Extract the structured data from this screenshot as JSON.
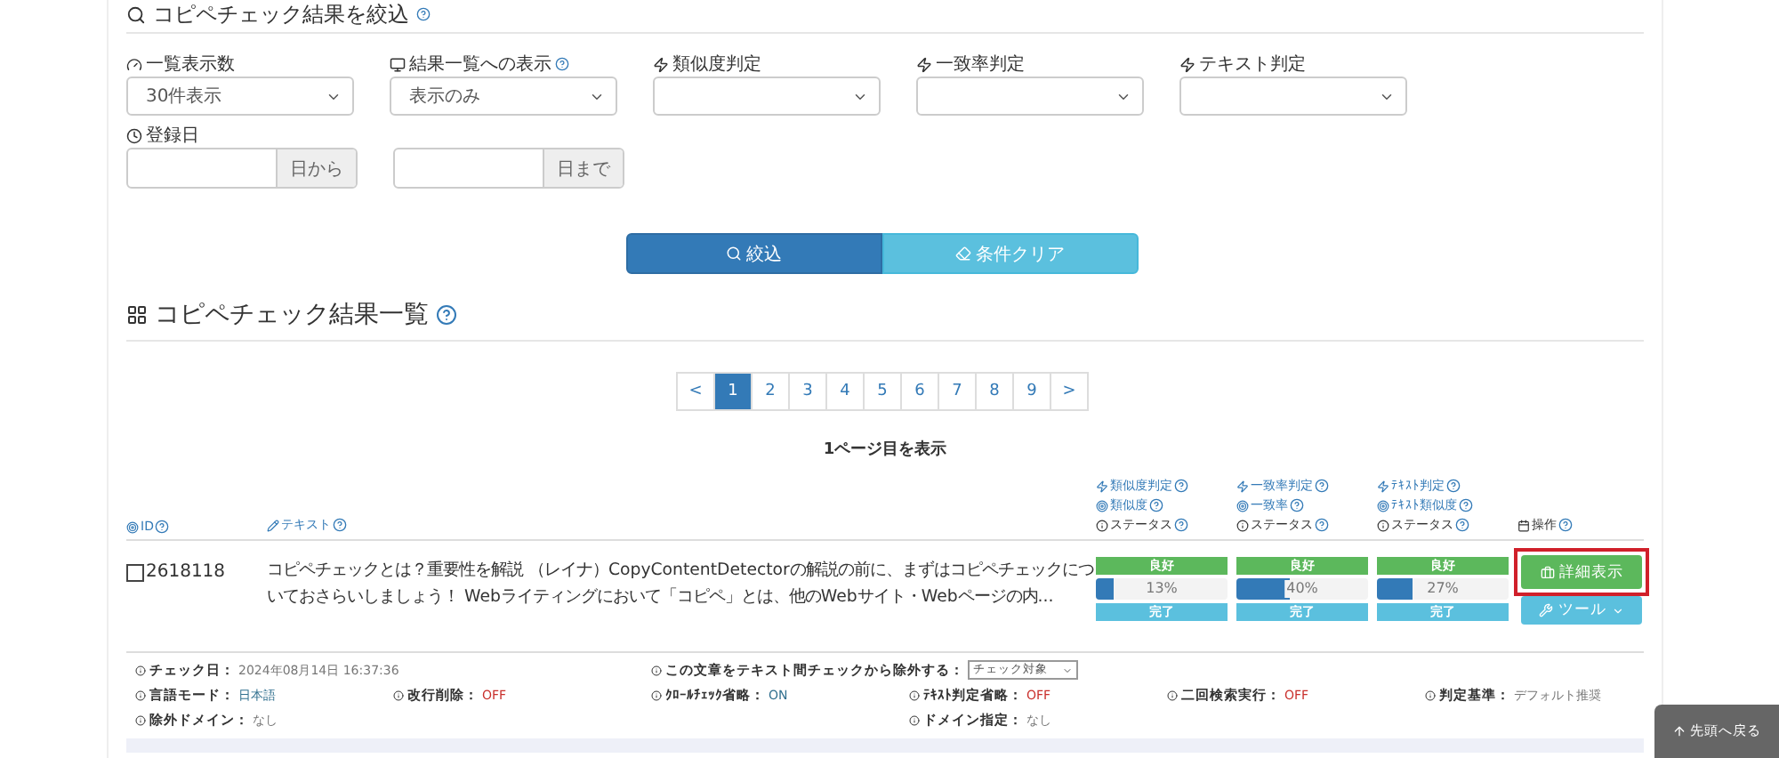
{
  "filter_panel": {
    "title": "コピペチェック結果を絞込",
    "filters": [
      {
        "label": "一覧表示数",
        "value": "30件表示",
        "help": false
      },
      {
        "label": "結果一覧への表示",
        "value": "表示のみ",
        "help": true
      },
      {
        "label": "類似度判定",
        "help": false
      },
      {
        "label": "一致率判定",
        "help": false
      },
      {
        "label": "テキスト判定",
        "help": false
      }
    ],
    "date": {
      "label": "登録日",
      "fields": [
        {
          "suffix": "日から"
        },
        {
          "suffix": "日まで"
        }
      ]
    },
    "buttons": [
      {
        "kind": "search",
        "label": "絞込"
      },
      {
        "kind": "clear",
        "label": "条件クリア"
      }
    ]
  },
  "results": {
    "title": "コピペチェック結果一覧",
    "pagination": [
      {
        "label": "<",
        "selected": false
      },
      {
        "label": "1",
        "selected": true
      },
      {
        "label": "2",
        "selected": false
      },
      {
        "label": "3",
        "selected": false
      },
      {
        "label": "4",
        "selected": false
      },
      {
        "label": "5",
        "selected": false
      },
      {
        "label": "6",
        "selected": false
      },
      {
        "label": "7",
        "selected": false
      },
      {
        "label": "8",
        "selected": false
      },
      {
        "label": "9",
        "selected": false
      },
      {
        "label": ">",
        "selected": false
      }
    ],
    "page_info": "1ページ目を表示",
    "columns": {
      "id": "ID",
      "text": "テキスト",
      "judgments": [
        [
          "類似度判定",
          "類似度",
          "ステータス"
        ],
        [
          "一致率判定",
          "一致率",
          "ステータス"
        ],
        [
          "ﾃｷｽﾄ判定",
          "ﾃｷｽﾄ類似度",
          "ステータス"
        ]
      ],
      "operations": "操作"
    },
    "rows": [
      {
        "id": "2618118",
        "checked": false,
        "text": "コピペチェックとは？重要性を解説 （レイナ）CopyContentDetectorの解説の前に、まずはコピペチェックについておさらいしましょう！ Webライティングにおいて「コピペ」とは、他のWebサイト・Webページの内...",
        "judgments": [
          {
            "verdict": "良好",
            "level": 0.13,
            "reading": "13%",
            "status": "完了"
          },
          {
            "verdict": "良好",
            "level": 0.4,
            "reading": "40%",
            "status": "完了"
          },
          {
            "verdict": "良好",
            "level": 0.27,
            "reading": "27%",
            "status": "完了"
          }
        ],
        "detail_button": "詳細表示",
        "detail_highlighted": true,
        "tool_button": "ツール",
        "details": [
          [
            {
              "label": "チェック日：",
              "value": "2024年08月14日 16:37:36",
              "color": "#777777"
            },
            {
              "label": "この文章をテキスト間チェックから除外する：",
              "select": "チェック対象"
            }
          ],
          [
            {
              "label": "言語モード：",
              "value": "日本語",
              "color": "#31708f"
            },
            {
              "label": "改行削除：",
              "value": "OFF",
              "color": "#c9302c"
            },
            {
              "label": "ｸﾛｰﾙﾁｪｯｸ省略：",
              "value": "ON",
              "color": "#31708f"
            },
            {
              "label": "ﾃｷｽﾄ判定省略：",
              "value": "OFF",
              "color": "#c9302c"
            },
            {
              "label": "二回検索実行：",
              "value": "OFF",
              "color": "#c9302c"
            },
            {
              "label": "判定基準：",
              "value": "デフォルト推奨",
              "color": "#777777"
            }
          ],
          [
            {
              "label": "除外ドメイン：",
              "value": "なし",
              "color": "#777777"
            },
            {
              "label": "ドメイン指定：",
              "value": "なし",
              "color": "#777777"
            }
          ]
        ]
      }
    ]
  },
  "back_to_top": "先頭へ戻る"
}
